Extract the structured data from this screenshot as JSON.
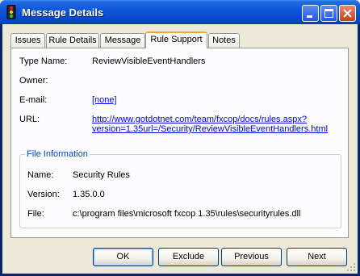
{
  "window": {
    "title": "Message Details"
  },
  "tabs": [
    {
      "label": "Issues"
    },
    {
      "label": "Rule Details"
    },
    {
      "label": "Message"
    },
    {
      "label": "Rule Support"
    },
    {
      "label": "Notes"
    }
  ],
  "active_tab": "Rule Support",
  "rule_support": {
    "type_name_label": "Type Name:",
    "type_name_value": "ReviewVisibleEventHandlers",
    "owner_label": "Owner:",
    "owner_value": "",
    "email_label": "E-mail:",
    "email_value": "[none]",
    "url_label": "URL:",
    "url_line1": "http://www.gotdotnet.com/team/fxcop/docs/rules.aspx?",
    "url_line2": "version=1.35url=/Security/ReviewVisibleEventHandlers.html"
  },
  "file_information": {
    "title": "File Information",
    "name_label": "Name:",
    "name_value": "Security Rules",
    "version_label": "Version:",
    "version_value": "1.35.0.0",
    "file_label": "File:",
    "file_value": "c:\\program files\\microsoft fxcop 1.35\\rules\\securityrules.dll"
  },
  "buttons": {
    "ok": "OK",
    "exclude": "Exclude",
    "previous": "Previous",
    "next": "Next"
  },
  "colors": {
    "title_bar": "#0d55d8",
    "link": "#0000ff",
    "group_title": "#0046d5",
    "active_tab_accent": "#f3a836"
  }
}
